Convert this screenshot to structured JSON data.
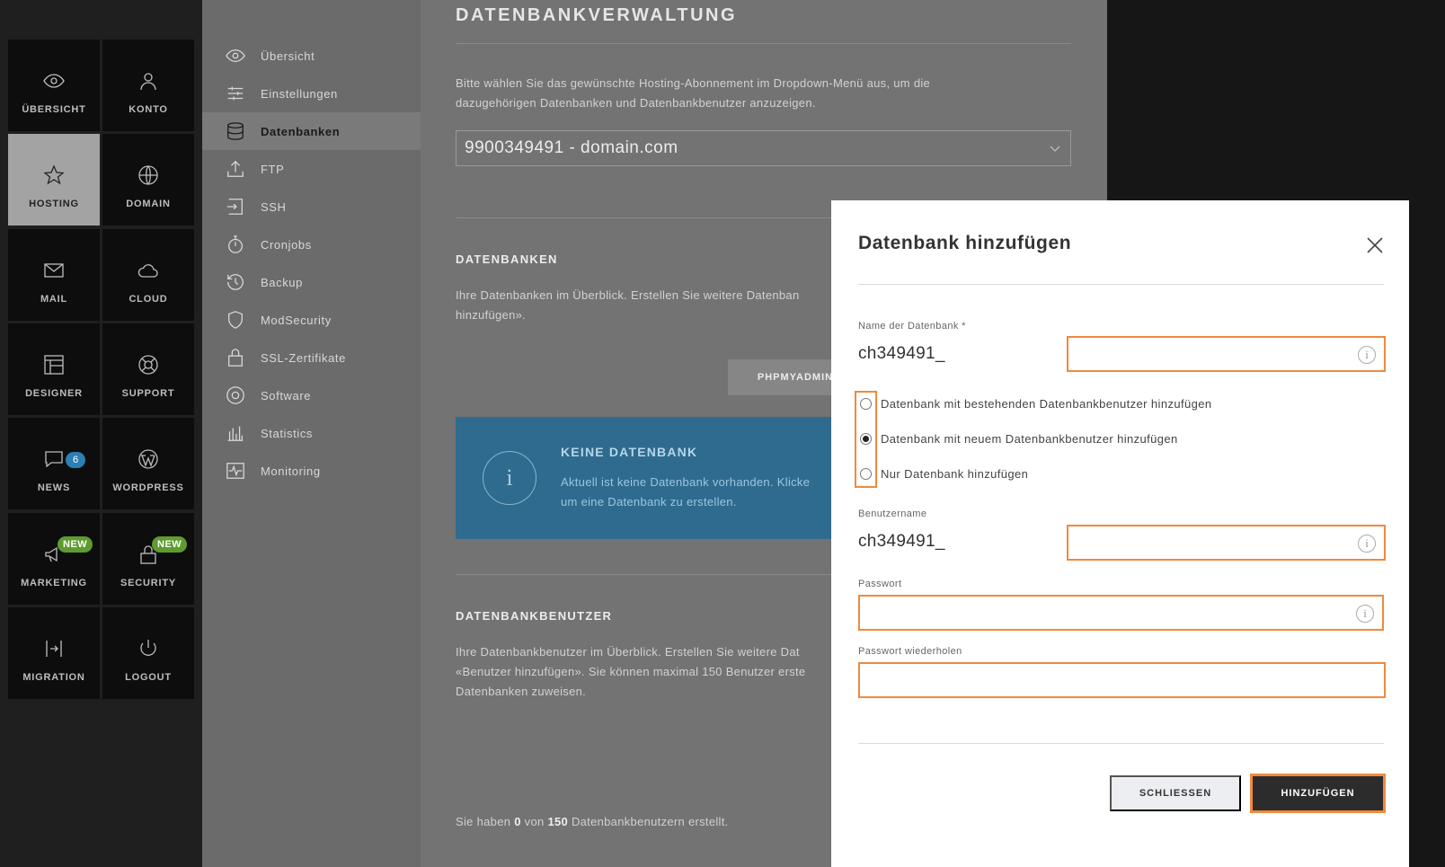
{
  "tile_nav": [
    {
      "label": "ÜBERSICHT",
      "icon": "eye-icon"
    },
    {
      "label": "KONTO",
      "icon": "user-icon"
    },
    {
      "label": "HOSTING",
      "icon": "star-icon",
      "active": true
    },
    {
      "label": "DOMAIN",
      "icon": "globe-icon"
    },
    {
      "label": "MAIL",
      "icon": "mail-icon"
    },
    {
      "label": "CLOUD",
      "icon": "cloud-icon"
    },
    {
      "label": "DESIGNER",
      "icon": "layout-icon"
    },
    {
      "label": "SUPPORT",
      "icon": "lifebuoy-icon"
    },
    {
      "label": "NEWS",
      "icon": "chat-icon",
      "badge": "6"
    },
    {
      "label": "WORDPRESS",
      "icon": "wordpress-icon"
    },
    {
      "label": "MARKETING",
      "icon": "megaphone-icon",
      "badge": "NEW"
    },
    {
      "label": "SECURITY",
      "icon": "lock-icon",
      "badge": "NEW"
    },
    {
      "label": "MIGRATION",
      "icon": "migration-icon"
    },
    {
      "label": "LOGOUT",
      "icon": "power-icon"
    }
  ],
  "sub_nav": [
    {
      "label": "Übersicht",
      "icon": "eye-icon"
    },
    {
      "label": "Einstellungen",
      "icon": "sliders-icon"
    },
    {
      "label": "Datenbanken",
      "icon": "database-icon",
      "active": true
    },
    {
      "label": "FTP",
      "icon": "upload-icon"
    },
    {
      "label": "SSH",
      "icon": "terminal-icon"
    },
    {
      "label": "Cronjobs",
      "icon": "stopwatch-icon"
    },
    {
      "label": "Backup",
      "icon": "history-icon"
    },
    {
      "label": "ModSecurity",
      "icon": "shield-icon"
    },
    {
      "label": "SSL-Zertifikate",
      "icon": "padlock-icon"
    },
    {
      "label": "Software",
      "icon": "disc-icon"
    },
    {
      "label": "Statistics",
      "icon": "barchart-icon"
    },
    {
      "label": "Monitoring",
      "icon": "pulse-icon"
    }
  ],
  "main": {
    "title": "DATENBANKVERWALTUNG",
    "intro_line1": "Bitte wählen Sie das gewünschte Hosting-Abonnement im Dropdown-Menü aus, um die",
    "intro_line2": "dazugehörigen Datenbanken und Datenbankbenutzer anzuzeigen.",
    "subscription": "9900349491 - domain.com",
    "db_title": "DATENBANKEN",
    "db_text_line1": "Ihre Datenbanken im Überblick. Erstellen Sie weitere Datenban",
    "db_text_line2": "hinzufügen».",
    "phpmyadmin": "PHPMYADMIN",
    "info_title": "KEINE DATENBANK",
    "info_line1": "Aktuell ist keine Datenbank vorhanden. Klicke",
    "info_line2": "um eine Datenbank zu erstellen.",
    "users_title": "DATENBANKBENUTZER",
    "users_line1": "Ihre Datenbankbenutzer im Überblick. Erstellen Sie weitere Dat",
    "users_line2": "«Benutzer hinzufügen». Sie können maximal 150 Benutzer erste",
    "users_line3": "Datenbanken zuweisen.",
    "count_prefix": "Sie haben",
    "count_value": "0",
    "count_mid": "von",
    "count_max": "150",
    "count_suffix": "Datenbankbenutzern erstellt."
  },
  "modal": {
    "title": "Datenbank hinzufügen",
    "db_name_label": "Name der Datenbank *",
    "db_prefix": "ch349491_",
    "db_name_value": "",
    "radio_options": [
      {
        "label": "Datenbank mit bestehenden Datenbankbenutzer hinzufügen",
        "checked": false
      },
      {
        "label": "Datenbank mit neuem Datenbankbenutzer hinzufügen",
        "checked": true
      },
      {
        "label": "Nur Datenbank hinzufügen",
        "checked": false
      }
    ],
    "username_label": "Benutzername",
    "user_prefix": "ch349491_",
    "username_value": "",
    "password_label": "Passwort",
    "password_value": "",
    "password_repeat_label": "Passwort wiederholen",
    "password_repeat_value": "",
    "close_button": "SCHLIESSEN",
    "submit_button": "HINZUFÜGEN"
  },
  "colors": {
    "highlight": "#ef8a3e",
    "info_box": "#2f6b8f",
    "primary_button": "#2c2c2c"
  }
}
